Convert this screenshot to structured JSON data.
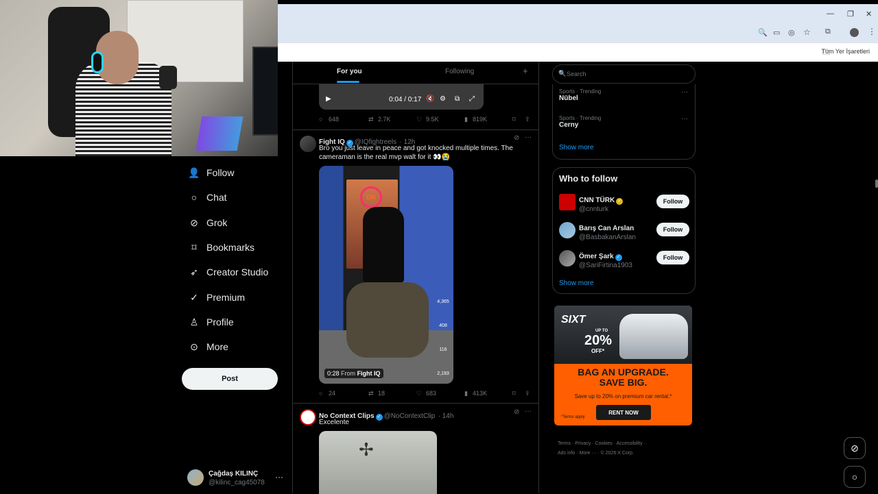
{
  "browser": {
    "bookmarks_label": "Tüm Yer İşaretleri",
    "window_min": "—",
    "window_restore": "❐",
    "window_close": "✕"
  },
  "nav": {
    "items": [
      {
        "label": "Follow",
        "icon": "person-plus-icon",
        "glyph": "👤"
      },
      {
        "label": "Chat",
        "icon": "chat-icon",
        "glyph": "💬"
      },
      {
        "label": "Grok",
        "icon": "grok-icon",
        "glyph": "⊘"
      },
      {
        "label": "Bookmarks",
        "icon": "bookmark-icon",
        "glyph": "🔖"
      },
      {
        "label": "Creator Studio",
        "icon": "rocket-icon",
        "glyph": "🚀"
      },
      {
        "label": "Premium",
        "icon": "verified-icon",
        "glyph": "✓"
      },
      {
        "label": "Profile",
        "icon": "profile-icon",
        "glyph": "👤"
      },
      {
        "label": "More",
        "icon": "more-circle-icon",
        "glyph": "⋯"
      }
    ],
    "post_label": "Post"
  },
  "account": {
    "name": "Çağdaş KILINÇ",
    "handle": "@kilinc_cag45078"
  },
  "feed": {
    "tab_foryou": "For you",
    "tab_following": "Following",
    "post1": {
      "time": "0:04 / 0:17",
      "replies": "648",
      "reposts": "2.7K",
      "likes": "9.5K",
      "views": "819K"
    },
    "post2": {
      "name": "Fight IQ",
      "handle": "@IQfightreels",
      "age": "· 12h",
      "text": "Bro you just leave in peace and got knocked multiple times. The cameraman is the real mvp walt for it 👀😭",
      "video_time": "0:28",
      "video_from": "From",
      "video_source": "Fight IQ",
      "side_counts": [
        "4,365",
        "408",
        "116",
        "2,193"
      ],
      "replies": "24",
      "reposts": "18",
      "likes": "683",
      "views": "413K"
    },
    "post3": {
      "name": "No Context Clips",
      "handle": "@NoContextClip",
      "age": "· 14h",
      "text": "Excelente"
    }
  },
  "search": {
    "placeholder": "Search"
  },
  "trends": [
    {
      "category": "Sports · Trending",
      "name": "Nübel"
    },
    {
      "category": "Sports · Trending",
      "name": "Cerny"
    }
  ],
  "trends_show_more": "Show more",
  "who_to_follow": {
    "title": "Who to follow",
    "accounts": [
      {
        "name": "CNN TÜRK",
        "handle": "@cnnturk",
        "badge": "gold"
      },
      {
        "name": "Barış Can Arslan",
        "handle": "@BasbakanArslan",
        "badge": "none"
      },
      {
        "name": "Ömer Şark",
        "handle": "@SariFirtina1903",
        "badge": "blue"
      }
    ],
    "follow_label": "Follow",
    "show_more": "Show more"
  },
  "ad": {
    "brand": "SIXT",
    "up_to": "UP TO",
    "percent": "20%",
    "off": "OFF*",
    "headline_1": "BAG AN UPGRADE.",
    "headline_2": "SAVE BIG.",
    "sub": "Save up to 20% on premium car rental.*",
    "cta": "RENT NOW",
    "terms": "*Terms apply"
  },
  "footer": {
    "links": [
      "Terms",
      "Privacy",
      "Cookies",
      "Accessibility",
      "Ads info",
      "More ···"
    ],
    "copyright": "© 2026 X Corp."
  },
  "colors": {
    "accent": "#1d9bf0",
    "background": "#000000",
    "border": "#2f3336"
  }
}
